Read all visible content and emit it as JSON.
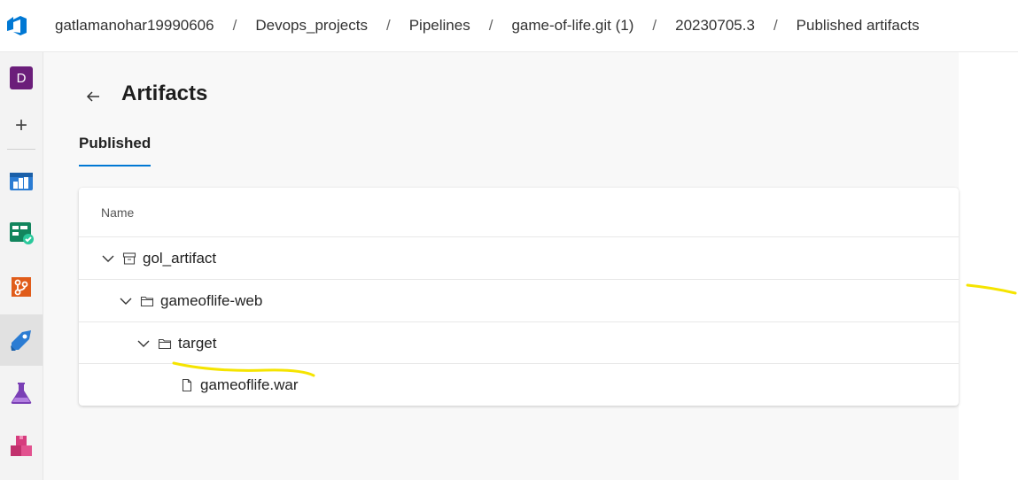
{
  "breadcrumb": {
    "org": "gatlamanohar19990606",
    "project": "Devops_projects",
    "section": "Pipelines",
    "pipeline": "game-of-life.git (1)",
    "run": "20230705.3",
    "page": "Published artifacts",
    "separator": "/"
  },
  "sidebar": {
    "avatar_letter": "D",
    "add_symbol": "+"
  },
  "page": {
    "title": "Artifacts",
    "tab": "Published"
  },
  "table": {
    "column_name": "Name",
    "rows": [
      {
        "label": "gol_artifact",
        "type": "artifact"
      },
      {
        "label": "gameoflife-web",
        "type": "folder"
      },
      {
        "label": "target",
        "type": "folder"
      },
      {
        "label": "gameoflife.war",
        "type": "file"
      }
    ]
  },
  "colors": {
    "accent": "#0078d4",
    "highlight": "#f5e400"
  }
}
